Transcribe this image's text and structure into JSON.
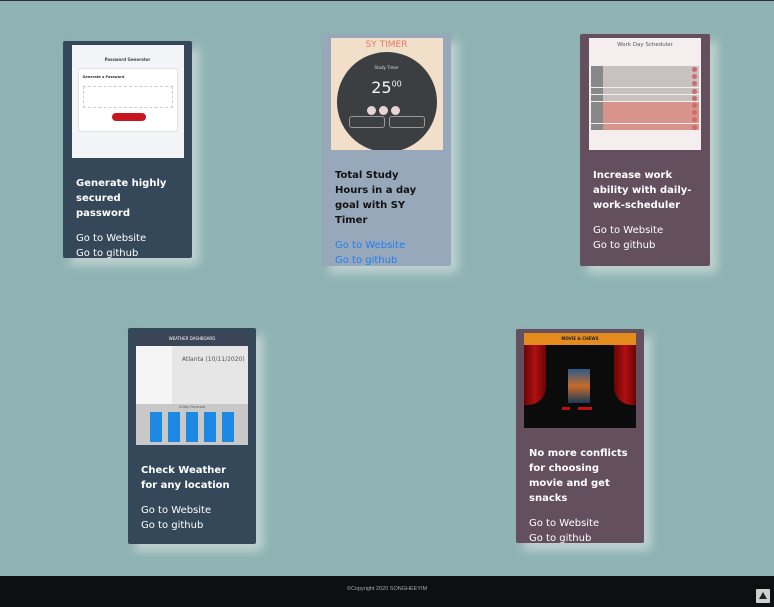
{
  "projects": [
    {
      "title": "Generate highly secured password",
      "website_label": "Go to Website",
      "github_label": "Go to github",
      "preview": {
        "heading": "Password Generator",
        "subheading": "Generate a Password",
        "placeholder": "Your Secure Password",
        "button": "Generate Password"
      }
    },
    {
      "title": "Total Study Hours in a day goal with SY Timer",
      "website_label": "Go to Website",
      "github_label": "Go to github",
      "preview": {
        "heading": "SY TIMER",
        "label": "Study Timer",
        "time": "25",
        "seconds": "00"
      }
    },
    {
      "title": "Increase work ability with daily-work-scheduler",
      "website_label": "Go to Website",
      "github_label": "Go to github",
      "preview": {
        "heading": "Work Day Scheduler"
      }
    },
    {
      "title": "Check Weather for any location",
      "website_label": "Go to Website",
      "github_label": "Go to github",
      "preview": {
        "heading": "WEATHER DASHBOARD",
        "city": "Atlanta (10/11/2020)",
        "forecast_label": "5-Day Forecast"
      }
    },
    {
      "title": "No more conflicts for choosing movie and get snacks",
      "website_label": "Go to Website",
      "github_label": "Go to github",
      "preview": {
        "heading": "MOVIE & CHEWS"
      }
    }
  ],
  "footer": {
    "copyright": "©Copyright 2020 SONGHEEYIM"
  },
  "colors": {
    "background": "#8fb3b3",
    "card_dark": "#34485a",
    "card_plum": "#644f5e",
    "card_slate": "#98a8bb",
    "link_blue": "#1e7ff0"
  },
  "icons": {
    "scroll_top": "triangle-up-icon"
  }
}
